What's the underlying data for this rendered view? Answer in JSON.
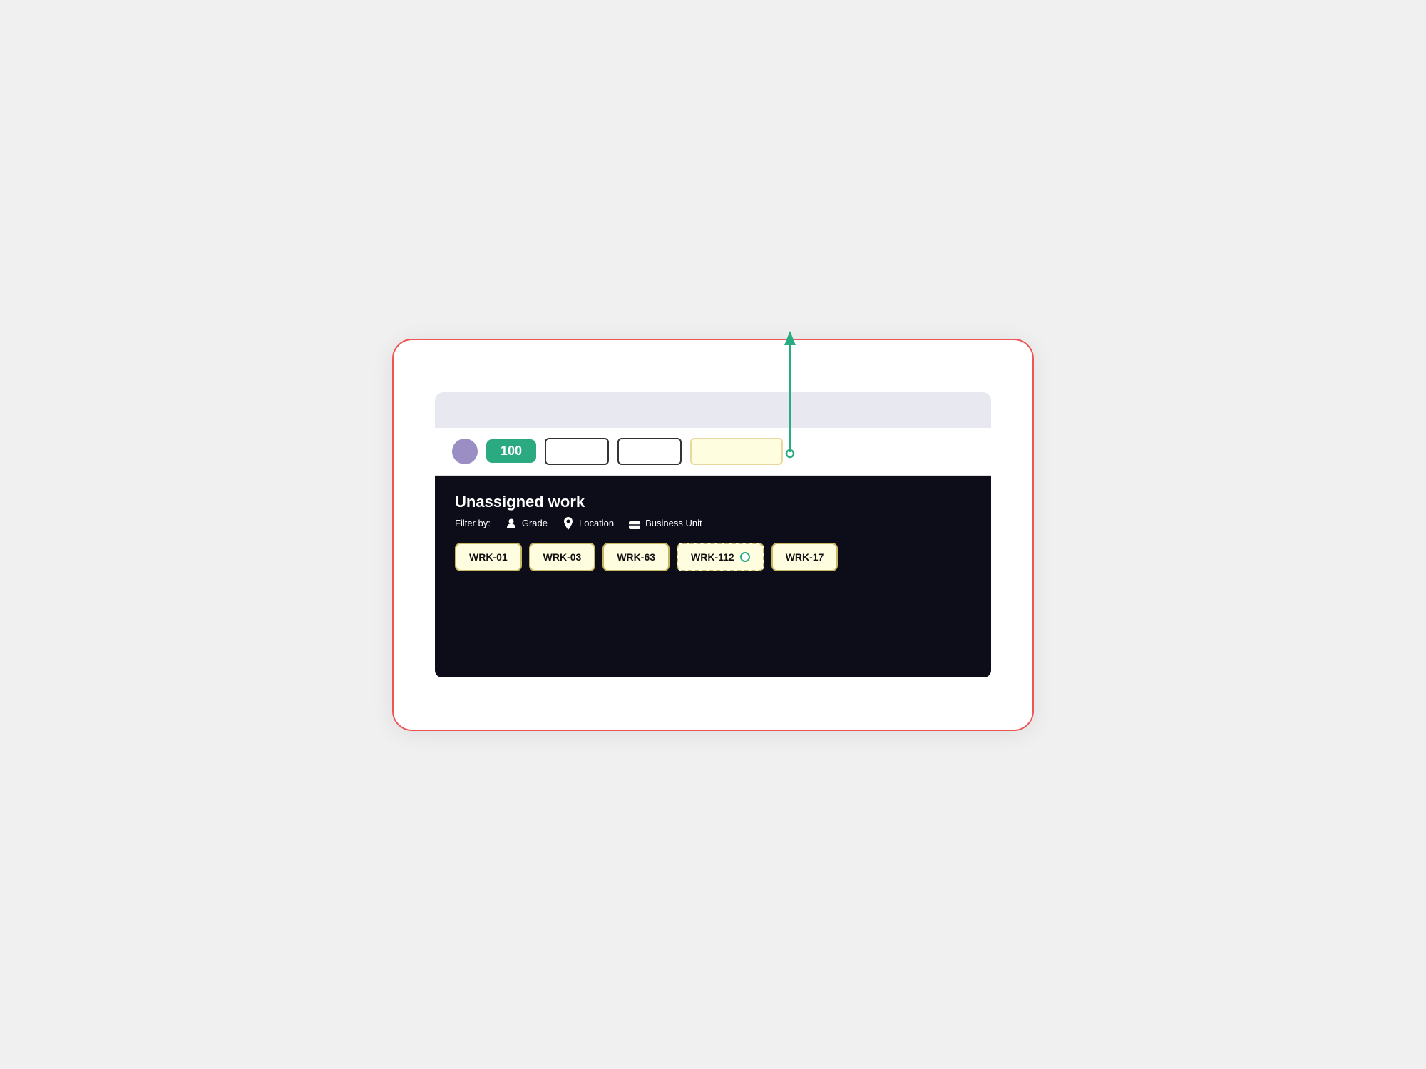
{
  "outer": {
    "bg": "white"
  },
  "toolbar": {
    "score": "100",
    "avatar_color": "#9b8ec4",
    "input1_placeholder": "",
    "input2_placeholder": "",
    "input3_placeholder": ""
  },
  "panel": {
    "title": "Unassigned work",
    "filter_label": "Filter by:",
    "filters": [
      {
        "icon": "grade-icon",
        "label": "Grade"
      },
      {
        "icon": "location-icon",
        "label": "Location"
      },
      {
        "icon": "briefcase-icon",
        "label": "Business Unit"
      }
    ],
    "work_items": [
      {
        "id": "WRK-01",
        "active": false
      },
      {
        "id": "WRK-03",
        "active": false
      },
      {
        "id": "WRK-63",
        "active": false
      },
      {
        "id": "WRK-112",
        "active": true
      },
      {
        "id": "WRK-17",
        "active": false
      }
    ]
  },
  "annotation": {
    "arrow_color": "#2baa82"
  }
}
